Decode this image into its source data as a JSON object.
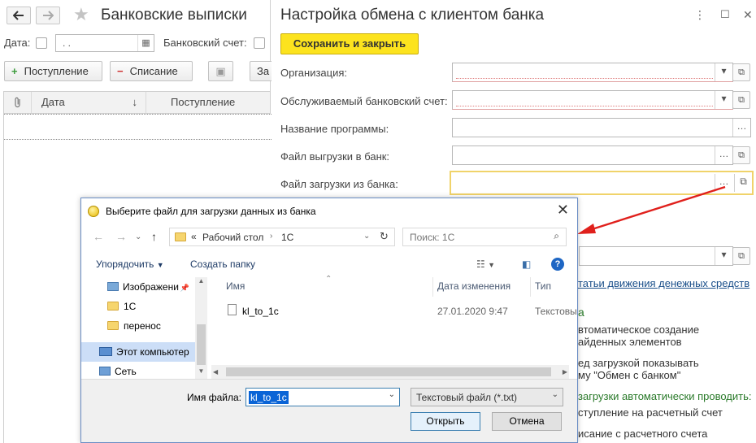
{
  "left": {
    "title": "Банковские выписки",
    "date_label": "Дата:",
    "date_value": ".  .",
    "account_label": "Банковский счет:",
    "toolbar": {
      "income": "Поступление",
      "expense": "Списание",
      "more": "За"
    },
    "columns": [
      "Дата",
      "Поступление"
    ]
  },
  "form": {
    "title": "Настройка обмена с клиентом банка",
    "save_close": "Сохранить и закрыть",
    "fields": {
      "org": "Организация:",
      "account": "Обслуживаемый банковский счет:",
      "program": "Название программы:",
      "upload": "Файл выгрузки в банк:",
      "download": "Файл загрузки из банка:"
    },
    "right_texts": {
      "cash_flow": "татьи движения денежных средств",
      "section_a": "а",
      "auto_create_1": "втоматическое создание",
      "auto_create_2": "айденных элементов",
      "show_before_1": "ед загрузкой показывать",
      "show_before_2": "му \"Обмен с банком\"",
      "auto_post": "загрузки автоматически проводить:",
      "post_income": "ступление на расчетный счет",
      "post_expense": "исание с расчетного счета"
    }
  },
  "dialog": {
    "title": "Выберите файл для загрузки данных из банка",
    "path_prefix": "«",
    "path_parts": [
      "Рабочий стол",
      "1С"
    ],
    "search_placeholder": "Поиск: 1С",
    "organize": "Упорядочить",
    "new_folder": "Создать папку",
    "tree": [
      "Изображени",
      "1С",
      "перенос",
      "Этот компьютер",
      "Сеть"
    ],
    "columns": {
      "name": "Имя",
      "modified": "Дата изменения",
      "type": "Тип"
    },
    "files": [
      {
        "name": "kl_to_1c",
        "modified": "27.01.2020 9:47",
        "type": "Текстовы"
      }
    ],
    "filename_label": "Имя файла:",
    "filename_value": "kl_to_1c",
    "filetype_value": "Текстовый файл (*.txt)",
    "open": "Открыть",
    "cancel": "Отмена"
  },
  "colors": {
    "save_button": "#fce31e",
    "arrow": "#e0201c",
    "link": "#1a4f8a",
    "highlight": "#f0d36a"
  }
}
